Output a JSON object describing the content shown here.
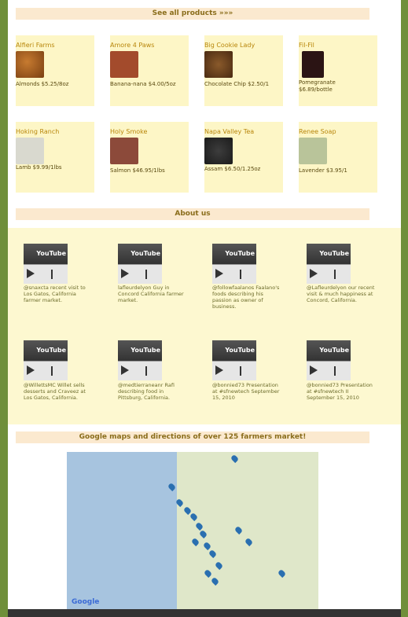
{
  "header": {
    "see_all": "See all products »»»"
  },
  "vendors": [
    {
      "name": "Alfieri Farms",
      "price": "Almonds $5.25/8oz"
    },
    {
      "name": "Amore 4 Paws",
      "price": "Banana-nana $4.00/5oz"
    },
    {
      "name": "Big Cookie Lady",
      "price": "Chocolate Chip $2.50/1"
    },
    {
      "name": "Fil-Fil",
      "price": "Pomegranate $6.89/bottle"
    },
    {
      "name": "Hoking Ranch",
      "price": "Lamb $9.99/1lbs"
    },
    {
      "name": "Holy Smoke",
      "price": "Salmon $46.95/1lbs"
    },
    {
      "name": "Napa Valley Tea",
      "price": "Assam $6.50/1.25oz"
    },
    {
      "name": "Renee Soap",
      "price": "Lavender $3.95/1"
    }
  ],
  "about": {
    "title": "About us"
  },
  "videos": [
    {
      "caption": "@snaxcta recent visit to Los Gatos, California farmer market."
    },
    {
      "caption": "lafleurdelyon Guy in Concord California farmer market."
    },
    {
      "caption": "@followfaalanos Faalano's foods describing his passion as owner of business."
    },
    {
      "caption": "@Lafleurdelyon our recent visit & much happiness at Concord, California."
    },
    {
      "caption": "@WillettsMC Willet sells desserts and Craveez at Los Gatos, California."
    },
    {
      "caption": "@medtierraneanr Rafi describing food in Pittsburg, California."
    },
    {
      "caption": "@bonnied73 Presentation at #sfnewtech September 15, 2010"
    },
    {
      "caption": "@bonnied73 Presentation at #sfnewtech II September 15, 2010"
    }
  ],
  "video_label": "YouTube",
  "maps": {
    "title": "Google maps and directions of over 125 farmers market!",
    "logo": "Google"
  },
  "colors": {
    "accent": "#8a6d1b",
    "tile": "#fdf6c6",
    "bar": "#fbe9cf",
    "background": "#6f8f3a"
  }
}
